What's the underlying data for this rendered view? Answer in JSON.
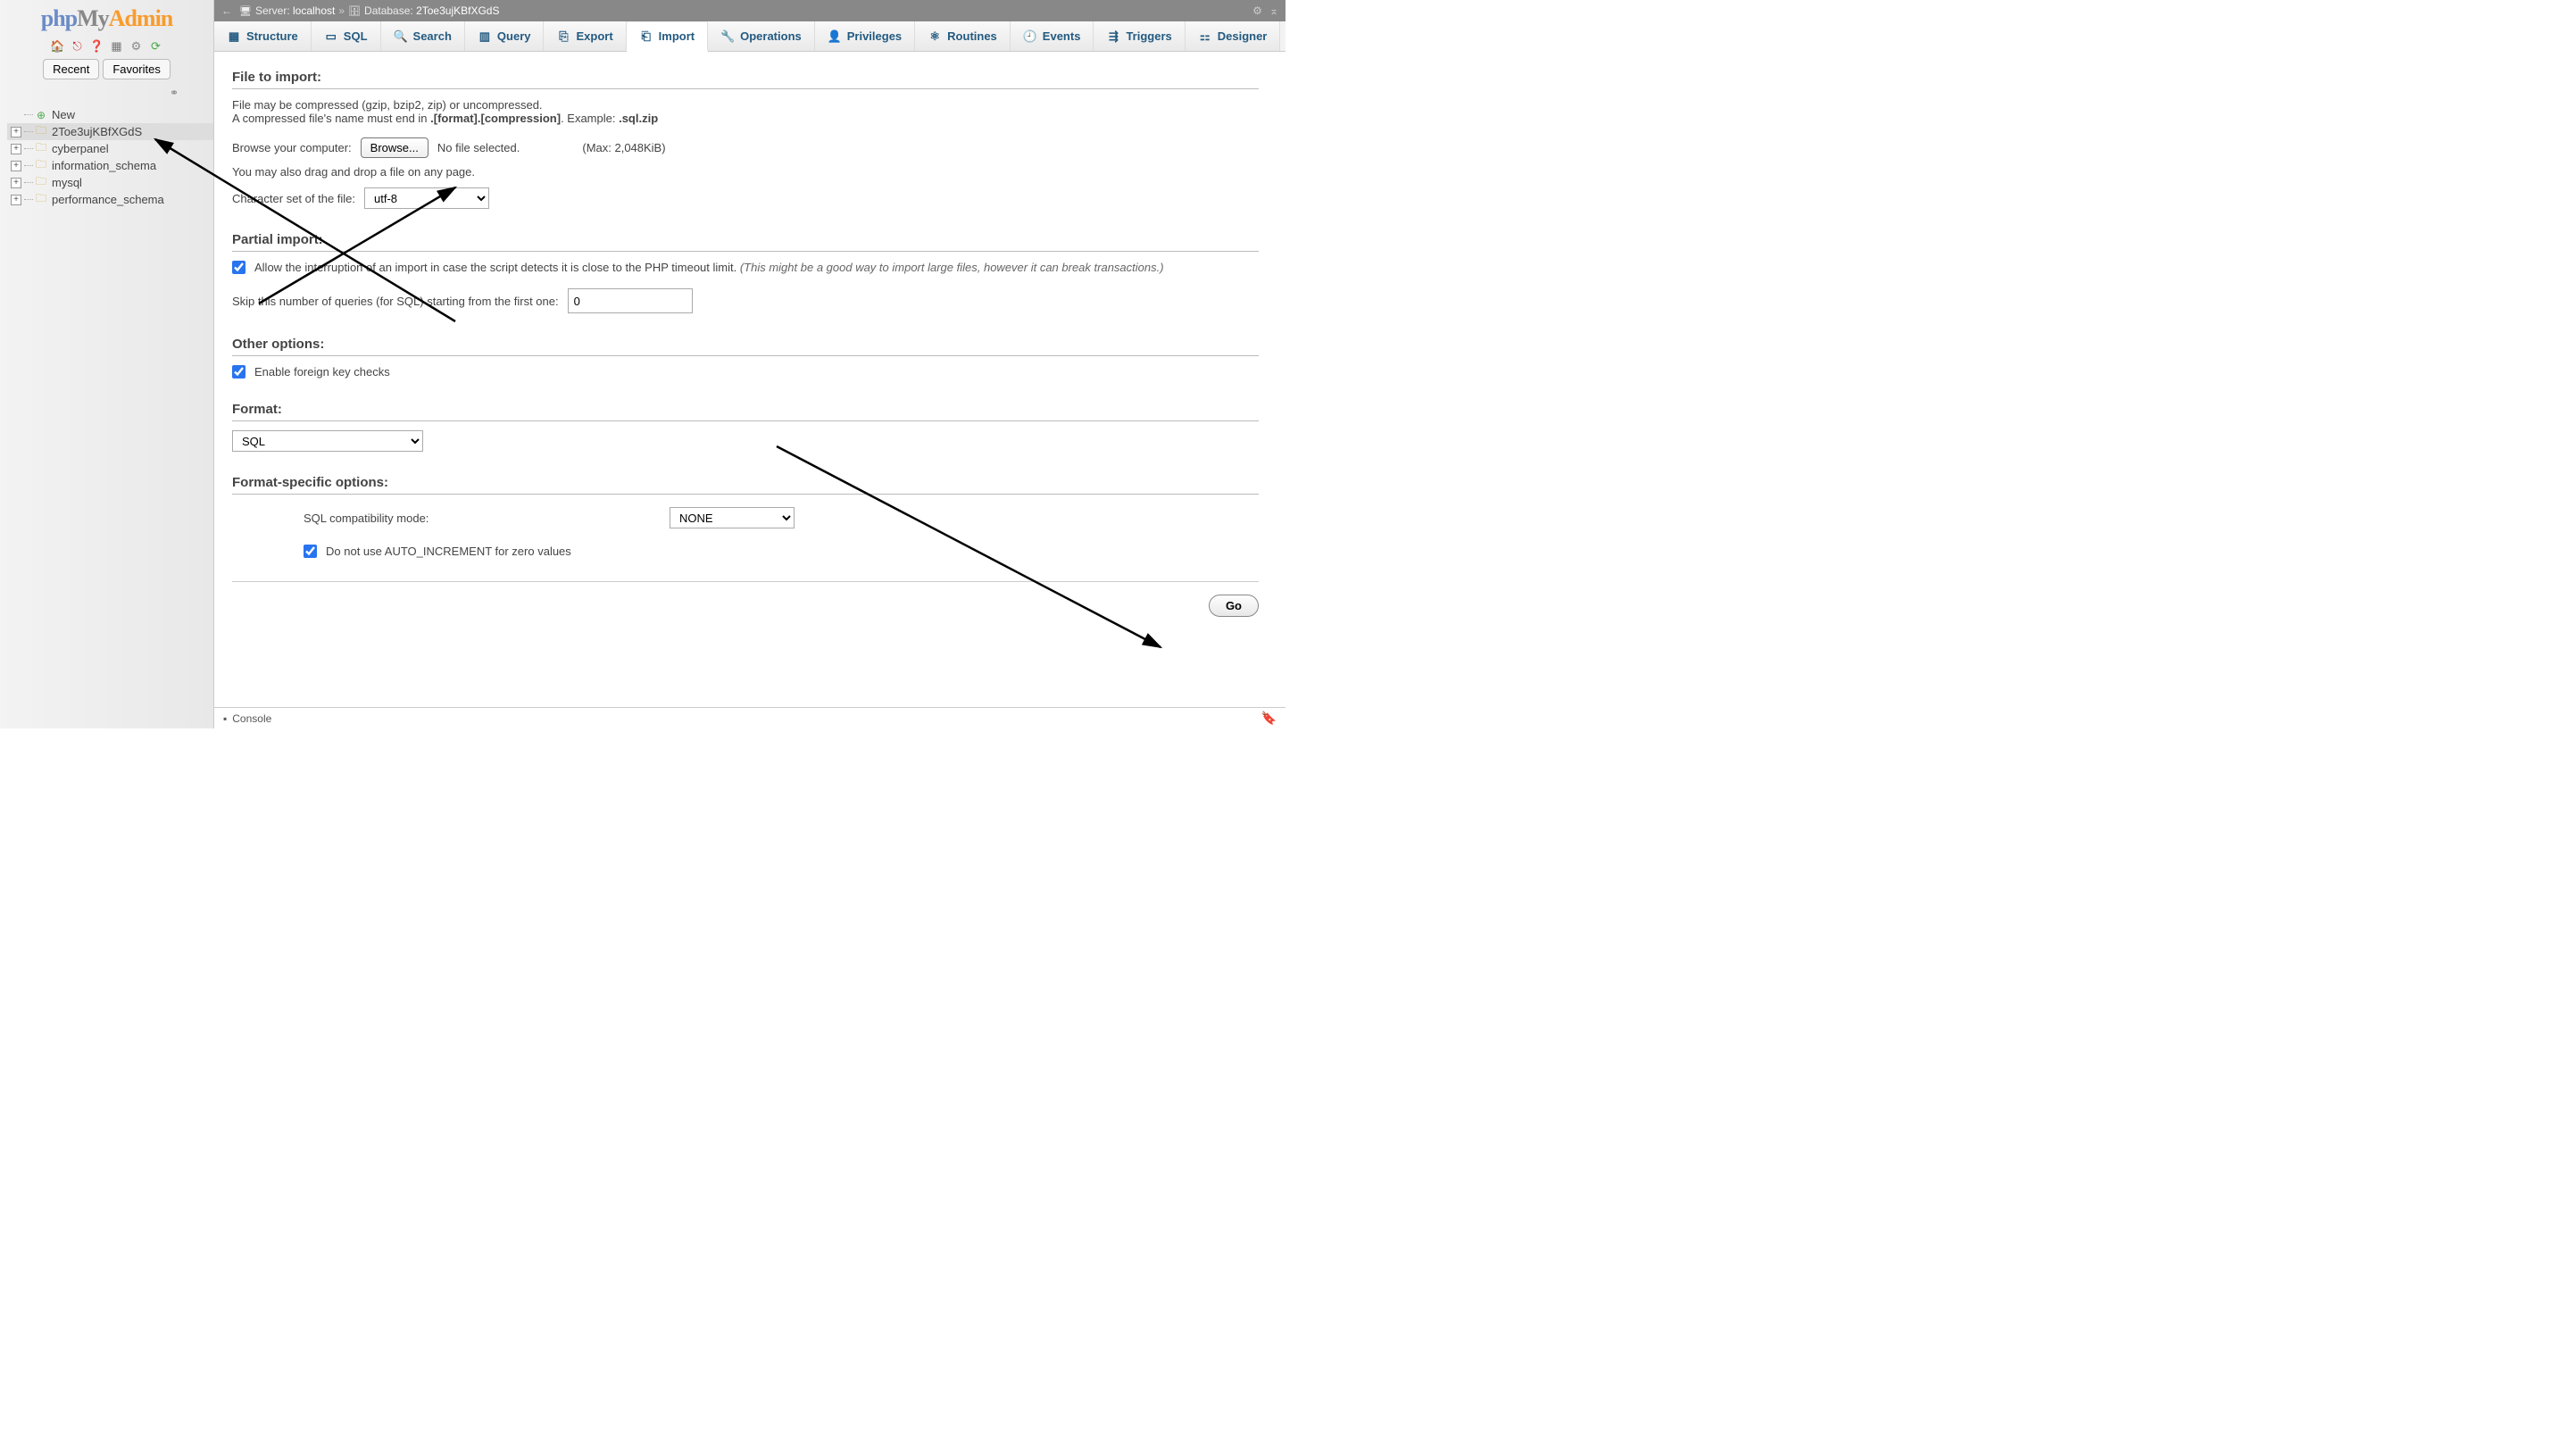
{
  "logo": {
    "p1": "php",
    "p2": "My",
    "p3": "Admin"
  },
  "sidebarTabs": {
    "recent": "Recent",
    "favorites": "Favorites"
  },
  "tree": {
    "new": "New",
    "items": [
      "2Toe3ujKBfXGdS",
      "cyberpanel",
      "information_schema",
      "mysql",
      "performance_schema"
    ]
  },
  "breadcrumb": {
    "serverLabel": "Server:",
    "serverVal": "localhost",
    "dbLabel": "Database:",
    "dbVal": "2Toe3ujKBfXGdS"
  },
  "tabs": [
    "Structure",
    "SQL",
    "Search",
    "Query",
    "Export",
    "Import",
    "Operations",
    "Privileges",
    "Routines",
    "Events",
    "Triggers",
    "Designer"
  ],
  "activeTab": "Import",
  "file": {
    "legend": "File to import:",
    "hint1": "File may be compressed (gzip, bzip2, zip) or uncompressed.",
    "hint2a": "A compressed file's name must end in ",
    "hint2b": ".[format].[compression]",
    "hint2c": ". Example: ",
    "hint2d": ".sql.zip",
    "browseLabel": "Browse your computer:",
    "browseBtn": "Browse...",
    "noFile": "No file selected.",
    "max": "(Max: 2,048KiB)",
    "drag": "You may also drag and drop a file on any page.",
    "charsetLabel": "Character set of the file:",
    "charset": "utf-8"
  },
  "partial": {
    "legend": "Partial import:",
    "allow": "Allow the interruption of an import in case the script detects it is close to the PHP timeout limit. ",
    "allowItalic": "(This might be a good way to import large files, however it can break transactions.)",
    "skipLabel": "Skip this number of queries (for SQL) starting from the first one:",
    "skipVal": "0"
  },
  "other": {
    "legend": "Other options:",
    "fk": "Enable foreign key checks"
  },
  "format": {
    "legend": "Format:",
    "value": "SQL"
  },
  "fso": {
    "legend": "Format-specific options:",
    "compatLabel": "SQL compatibility mode:",
    "compatVal": "NONE",
    "autoinc": "Do not use AUTO_INCREMENT for zero values"
  },
  "go": "Go",
  "console": "Console"
}
